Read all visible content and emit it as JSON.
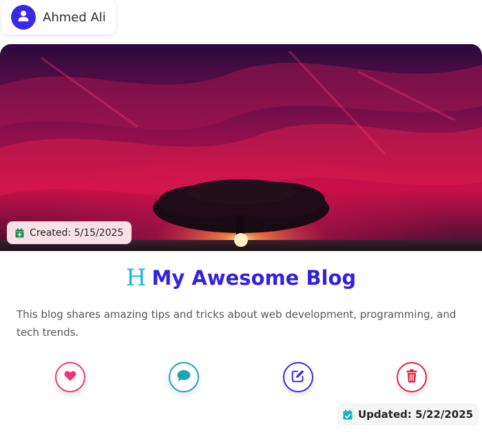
{
  "author": {
    "name": "Ahmed Ali",
    "icon": "user-icon"
  },
  "post": {
    "created_label": "Created: 5/15/2025",
    "title_glyph": "H",
    "title": "My Awesome Blog",
    "description": "This blog shares amazing tips and tricks about web development, programming, and tech trends.",
    "updated_label": "Updated: 5/22/2025"
  },
  "actions": [
    {
      "name": "like",
      "icon": "heart-icon",
      "color": "#f0347a"
    },
    {
      "name": "comment",
      "icon": "comment-icon",
      "color": "#1aa6b8"
    },
    {
      "name": "edit",
      "icon": "edit-icon",
      "color": "#3b28e6"
    },
    {
      "name": "delete",
      "icon": "trash-icon",
      "color": "#e8213a"
    }
  ],
  "colors": {
    "accent": "#3222e0",
    "title_icon": "#1cb8d8",
    "created_icon": "#1f8a4c",
    "updated_icon": "#12b5c9"
  }
}
